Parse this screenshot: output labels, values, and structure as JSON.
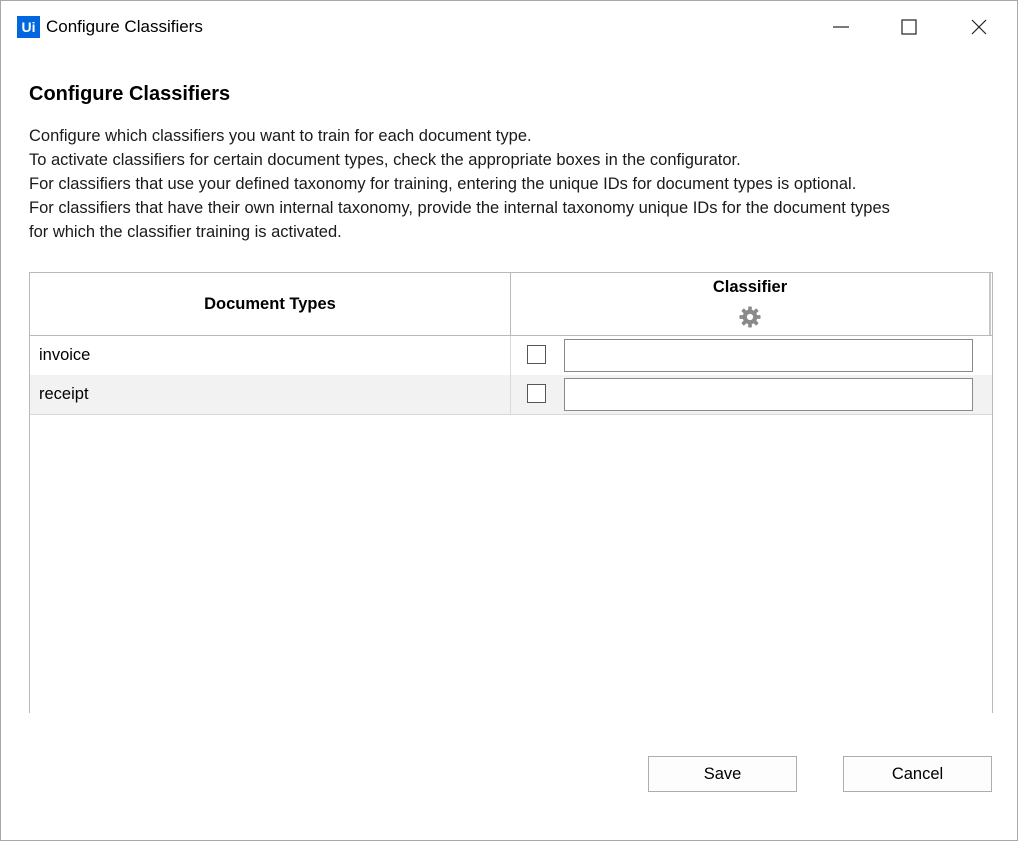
{
  "window": {
    "app_icon_text": "Ui",
    "title": "Configure Classifiers",
    "accent_color": "#0067df"
  },
  "controls": {
    "minimize_icon": "minimize-icon",
    "maximize_icon": "maximize-icon",
    "close_icon": "close-icon"
  },
  "content": {
    "heading": "Configure Classifiers",
    "description": [
      "Configure which classifiers you want to train for each document type.",
      "To activate classifiers for certain document types, check the appropriate boxes in the configurator.",
      "For classifiers that use your defined taxonomy for training, entering the unique IDs for document types is optional.",
      "For classifiers that have their own internal taxonomy, provide the internal taxonomy unique IDs for the document types",
      "for which the classifier training is activated."
    ]
  },
  "grid": {
    "columns": {
      "document_types": "Document Types",
      "classifier": "Classifier",
      "classifier_icon": "gear-icon"
    },
    "rows": [
      {
        "name": "invoice",
        "checked": false,
        "id_value": ""
      },
      {
        "name": "receipt",
        "checked": false,
        "id_value": ""
      }
    ]
  },
  "buttons": {
    "save": "Save",
    "cancel": "Cancel"
  }
}
